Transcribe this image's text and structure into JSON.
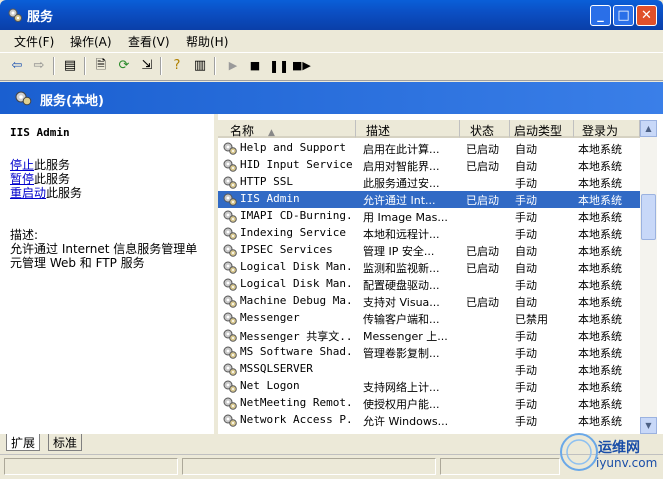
{
  "window": {
    "title": "服务"
  },
  "menu": [
    "文件(F)",
    "操作(A)",
    "查看(V)",
    "帮助(H)"
  ],
  "header": {
    "title": "服务(本地)"
  },
  "details": {
    "service_name": "IIS Admin",
    "actions": [
      {
        "link": "停止",
        "rest": "此服务"
      },
      {
        "link": "暂停",
        "rest": "此服务"
      },
      {
        "link": "重启动",
        "rest": "此服务"
      }
    ],
    "desc_label": "描述:",
    "desc_lines": [
      "允许通过 Internet 信息服务管理单",
      "元管理 Web 和 FTP 服务"
    ]
  },
  "columns": [
    "名称",
    "描述",
    "状态",
    "启动类型",
    "登录为"
  ],
  "services": [
    {
      "name": "Help and Support",
      "desc": "启用在此计算...",
      "status": "已启动",
      "startup": "自动",
      "logon": "本地系统"
    },
    {
      "name": "HID Input Service",
      "desc": "启用对智能界...",
      "status": "已启动",
      "startup": "自动",
      "logon": "本地系统"
    },
    {
      "name": "HTTP SSL",
      "desc": "此服务通过安...",
      "status": "",
      "startup": "手动",
      "logon": "本地系统"
    },
    {
      "name": "IIS Admin",
      "desc": "允许通过 Int...",
      "status": "已启动",
      "startup": "手动",
      "logon": "本地系统"
    },
    {
      "name": "IMAPI CD-Burning...",
      "desc": "用 Image Mas...",
      "status": "",
      "startup": "手动",
      "logon": "本地系统"
    },
    {
      "name": "Indexing Service",
      "desc": "本地和远程计...",
      "status": "",
      "startup": "手动",
      "logon": "本地系统"
    },
    {
      "name": "IPSEC Services",
      "desc": "管理 IP 安全...",
      "status": "已启动",
      "startup": "自动",
      "logon": "本地系统"
    },
    {
      "name": "Logical Disk Man...",
      "desc": "监测和监视新...",
      "status": "已启动",
      "startup": "自动",
      "logon": "本地系统"
    },
    {
      "name": "Logical Disk Man...",
      "desc": "配置硬盘驱动...",
      "status": "",
      "startup": "手动",
      "logon": "本地系统"
    },
    {
      "name": "Machine Debug Ma...",
      "desc": "支持对 Visua...",
      "status": "已启动",
      "startup": "自动",
      "logon": "本地系统"
    },
    {
      "name": "Messenger",
      "desc": "传输客户端和...",
      "status": "",
      "startup": "已禁用",
      "logon": "本地系统"
    },
    {
      "name": "Messenger 共享文...",
      "desc": "Messenger 上...",
      "status": "",
      "startup": "手动",
      "logon": "本地系统"
    },
    {
      "name": "MS Software Shad...",
      "desc": "管理卷影复制...",
      "status": "",
      "startup": "手动",
      "logon": "本地系统"
    },
    {
      "name": "MSSQLSERVER",
      "desc": "",
      "status": "",
      "startup": "手动",
      "logon": "本地系统"
    },
    {
      "name": "Net Logon",
      "desc": "支持网络上计...",
      "status": "",
      "startup": "手动",
      "logon": "本地系统"
    },
    {
      "name": "NetMeeting Remot...",
      "desc": "使授权用户能...",
      "status": "",
      "startup": "手动",
      "logon": "本地系统"
    },
    {
      "name": "Network Access P...",
      "desc": "允许 Windows...",
      "status": "",
      "startup": "手动",
      "logon": "本地系统"
    }
  ],
  "selected_index": 3,
  "tabs": [
    "扩展",
    "标准"
  ],
  "watermark": {
    "text": "运维网",
    "url": "iyunv.com"
  },
  "colors": {
    "title_blue": "#0b4fc4",
    "selection": "#316ac5",
    "link": "#0000cc"
  }
}
